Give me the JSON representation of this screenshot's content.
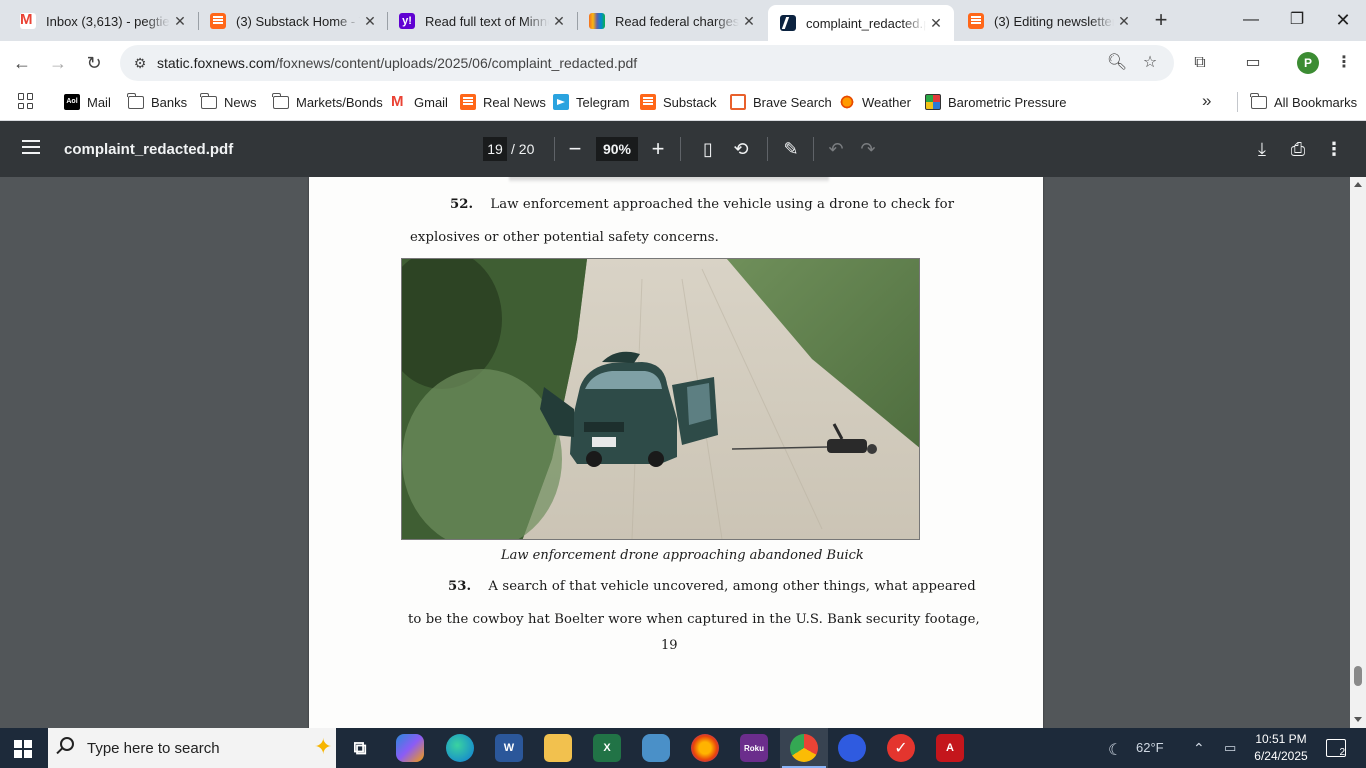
{
  "browser": {
    "tabs": [
      {
        "label": "Inbox (3,613) - pegtier",
        "favicon": "gmail-icon",
        "active": false
      },
      {
        "label": "(3) Substack Home - T",
        "favicon": "substack-icon",
        "active": false
      },
      {
        "label": "Read full text of Minne",
        "favicon": "yahoo-icon",
        "active": false
      },
      {
        "label": "Read federal charges a",
        "favicon": "nbc-peacock-icon",
        "active": false
      },
      {
        "label": "complaint_redacted.pd",
        "favicon": "fox-news-icon",
        "active": true
      },
      {
        "label": "(3) Editing newsletter",
        "favicon": "substack-icon",
        "active": false
      }
    ],
    "url_host": "static.foxnews.com",
    "url_path": "/foxnews/content/uploads/2025/06/complaint_redacted.pdf",
    "profile_initial": "P",
    "bookmarks": [
      {
        "label": "Mail",
        "icon": "aol-icon"
      },
      {
        "label": "Banks",
        "icon": "folder-icon"
      },
      {
        "label": "News",
        "icon": "folder-icon"
      },
      {
        "label": "Markets/Bonds",
        "icon": "folder-icon"
      },
      {
        "label": "Gmail",
        "icon": "gmail-icon"
      },
      {
        "label": "Real News",
        "icon": "substack-icon"
      },
      {
        "label": "Telegram",
        "icon": "telegram-icon"
      },
      {
        "label": "Substack",
        "icon": "substack-icon"
      },
      {
        "label": "Brave Search",
        "icon": "brave-icon"
      },
      {
        "label": "Weather",
        "icon": "weather-icon"
      },
      {
        "label": "Barometric Pressure",
        "icon": "barometer-icon"
      }
    ],
    "all_bookmarks_label": "All Bookmarks"
  },
  "pdf": {
    "filename": "complaint_redacted.pdf",
    "current_page": "19",
    "total_pages": "/ 20",
    "zoom": "90%",
    "paragraph_52_num": "52.",
    "paragraph_52_line1": "Law enforcement approached the vehicle using a drone to check for",
    "paragraph_52_line2": "explosives or other potential safety concerns.",
    "photo_description_icon": "drone-approaching-car-photo",
    "caption": "Law enforcement drone approaching abandoned Buick",
    "paragraph_53_num": "53.",
    "paragraph_53_line1": "A search of that vehicle uncovered, among other things, what appeared",
    "paragraph_53_line2": "to be the cowboy hat Boelter wore when captured in the U.S. Bank security footage,",
    "page_number": "19",
    "scroll_position_fraction": 0.92
  },
  "taskbar": {
    "search_placeholder": "Type here to search",
    "weather_temp": "62°F",
    "time": "10:51 PM",
    "date": "6/24/2025",
    "notification_count": "2"
  }
}
